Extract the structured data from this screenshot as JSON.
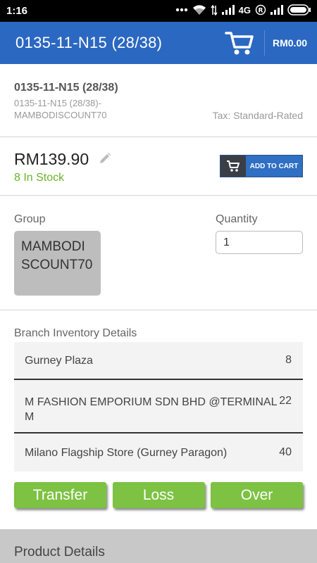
{
  "status_bar": {
    "time": "1:16",
    "network": "4G",
    "icons": [
      "more-dots-icon",
      "wifi-icon",
      "signal-icon",
      "roaming-icon",
      "battery-icon"
    ]
  },
  "app_bar": {
    "title": "0135-11-N15 (28/38)",
    "cart_total": "RM0.00",
    "background": "#2b68c1"
  },
  "product": {
    "name": "0135-11-N15 (28/38)",
    "code": "0135-11-N15 (28/38)-MAMBODISCOUNT70",
    "tax": "Tax: Standard-Rated",
    "price": "RM139.90",
    "stock": "8 In Stock",
    "add_to_cart_label": "ADD TO CART"
  },
  "group": {
    "label": "Group",
    "value": "MAMBODISCOUNT70"
  },
  "quantity": {
    "label": "Quantity",
    "value": "1"
  },
  "branch_inventory": {
    "title": "Branch Inventory Details",
    "rows": [
      {
        "name": "Gurney Plaza",
        "qty": "8"
      },
      {
        "name": "M FASHION EMPORIUM SDN BHD @TERMINAL M",
        "qty": "22"
      },
      {
        "name": "Milano Flagship Store (Gurney Paragon)",
        "qty": "40"
      }
    ]
  },
  "actions": {
    "transfer": "Transfer",
    "loss": "Loss",
    "over": "Over",
    "color": "#7dc242"
  },
  "product_details_label": "Product Details"
}
